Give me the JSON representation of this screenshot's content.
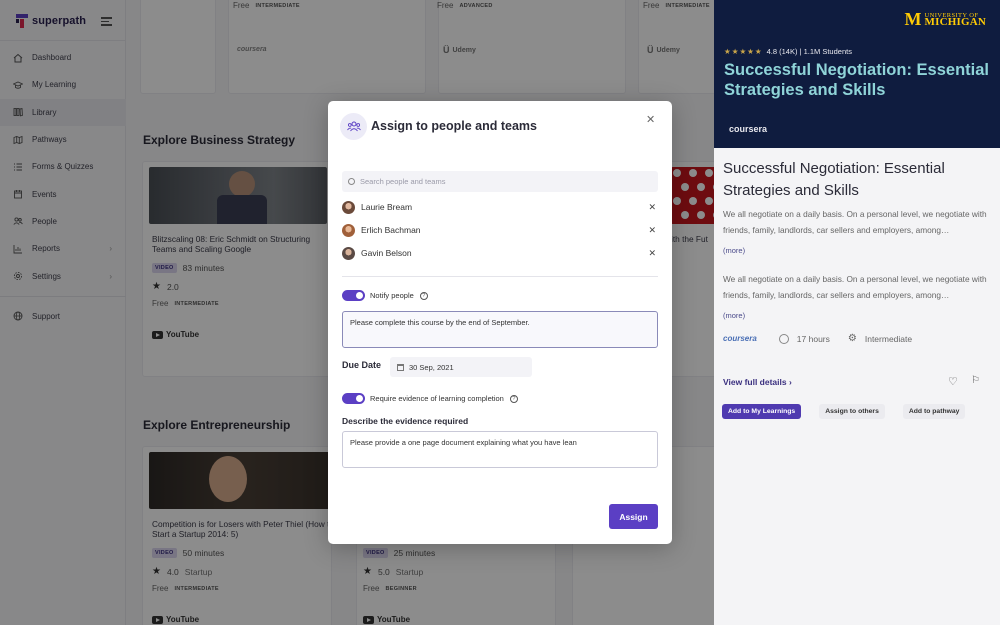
{
  "brand": {
    "name": "superpath"
  },
  "sidebar": {
    "items": [
      {
        "label": "Dashboard",
        "icon": "home-icon"
      },
      {
        "label": "My Learning",
        "icon": "graduation-cap-icon"
      },
      {
        "label": "Library",
        "icon": "library-icon",
        "active": true
      },
      {
        "label": "Pathways",
        "icon": "map-icon"
      },
      {
        "label": "Forms & Quizzes",
        "icon": "list-icon"
      },
      {
        "label": "Events",
        "icon": "calendar-icon"
      },
      {
        "label": "People",
        "icon": "people-icon"
      },
      {
        "label": "Reports",
        "icon": "chart-icon",
        "expandable": true
      },
      {
        "label": "Settings",
        "icon": "gear-icon",
        "expandable": true
      }
    ],
    "support": "Support"
  },
  "main": {
    "top_row": [
      {
        "price": "Free",
        "level": "INTERMEDIATE",
        "provider": "coursera"
      },
      {
        "price": "Free",
        "level": "ADVANCED",
        "provider": "Udemy"
      },
      {
        "price": "Free",
        "level": "INTERMEDIATE",
        "provider": "Udemy"
      }
    ],
    "sections": [
      {
        "title": "Explore Business Strategy",
        "cards": [
          {
            "title": "Blitzscaling 08: Eric Schmidt on Structuring Teams and Scaling Google",
            "type": "VIDEO",
            "duration": "83 minutes",
            "rating": "2.0",
            "price": "Free",
            "level": "INTERMEDIATE",
            "provider": "YouTube"
          },
          {
            "title_fragment": "ith the Fut"
          }
        ]
      },
      {
        "title": "Explore Entrepreneurship",
        "cards": [
          {
            "title": "Competition is for Losers with Peter Thiel (How to Start a Startup 2014: 5)",
            "type": "VIDEO",
            "duration": "50 minutes",
            "rating": "4.0",
            "category": "Startup",
            "price": "Free",
            "level": "INTERMEDIATE",
            "provider": "YouTube"
          },
          {
            "type": "VIDEO",
            "duration": "25 minutes",
            "rating": "5.0",
            "category": "Startup",
            "price": "Free",
            "level": "BEGINNER",
            "provider": "YouTube"
          }
        ]
      }
    ]
  },
  "course": {
    "university": {
      "line1": "UNIVERSITY OF",
      "line2": "MICHIGAN"
    },
    "rating": "4.8 (14K) | 1.1M Students",
    "hero_title": "Successful Negotiation: Essential Strategies and Skills",
    "hero_provider": "coursera",
    "title": "Successful Negotiation: Essential Strategies and Skills",
    "desc1": "We all negotiate on a daily basis. On a personal level, we negotiate with friends, family, landlords, car sellers and employers, among…",
    "desc2": "We all negotiate on a daily basis. On a personal level, we negotiate with friends, family, landlords, car sellers and employers, among…",
    "more": "(more)",
    "provider": "coursera",
    "hours": "17 hours",
    "level": "Intermediate",
    "view_full": "View full details",
    "buttons": {
      "add_my_learnings": "Add to My Learnings",
      "assign_others": "Assign to others",
      "add_pathway": "Add to pathway"
    }
  },
  "modal": {
    "title": "Assign to people and teams",
    "search_placeholder": "Search people and teams",
    "people": [
      {
        "name": "Laurie Bream",
        "avatar_color": "#6b4a3a"
      },
      {
        "name": "Erlich Bachman",
        "avatar_color": "#a0603a"
      },
      {
        "name": "Gavin Belson",
        "avatar_color": "#5a4a44"
      }
    ],
    "notify_label": "Notify people",
    "notify_on": true,
    "message": "Please complete this course by the end of September.",
    "due_label": "Due Date",
    "due_value": "30 Sep, 2021",
    "evidence_toggle_label": "Require evidence of learning completion",
    "evidence_on": true,
    "evidence_heading": "Describe the evidence required",
    "evidence_text": "Please provide a one page document explaining what you have lean",
    "assign_label": "Assign",
    "accent": "#5b3fc4"
  }
}
